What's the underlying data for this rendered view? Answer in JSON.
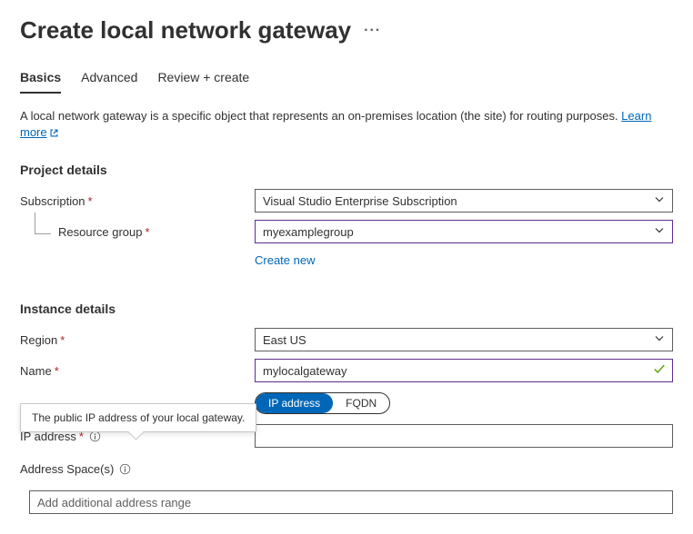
{
  "header": {
    "title": "Create local network gateway"
  },
  "tabs": {
    "basics": "Basics",
    "advanced": "Advanced",
    "review": "Review + create"
  },
  "description": {
    "text": "A local network gateway is a specific object that represents an on-premises location (the site) for routing purposes.  ",
    "learn_more": "Learn more"
  },
  "sections": {
    "project_details": "Project details",
    "instance_details": "Instance details"
  },
  "fields": {
    "subscription": {
      "label": "Subscription",
      "value": "Visual Studio Enterprise Subscription"
    },
    "resource_group": {
      "label": "Resource group",
      "value": "myexamplegroup",
      "create_new": "Create new"
    },
    "region": {
      "label": "Region",
      "value": "East US"
    },
    "name": {
      "label": "Name",
      "value": "mylocalgateway"
    },
    "endpoint": {
      "ip_address_option": "IP address",
      "fqdn_option": "FQDN"
    },
    "ip_address": {
      "label": "IP address",
      "value": ""
    },
    "address_space": {
      "label": "Address Space(s)",
      "placeholder": "Add additional address range"
    }
  },
  "tooltip": {
    "ip_address_hint": "The public IP address of your local gateway."
  }
}
